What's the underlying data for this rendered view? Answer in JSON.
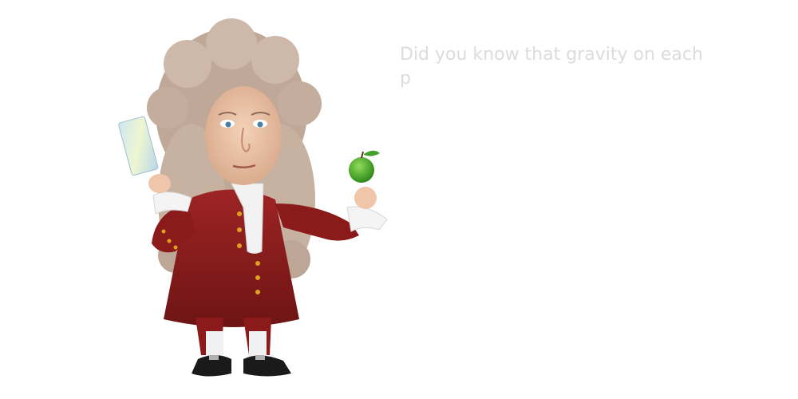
{
  "slide": {
    "text": "Did you know that gravity on each p"
  },
  "illustration": {
    "subject": "scientist-caricature",
    "props": [
      "paper-note",
      "green-apple"
    ]
  },
  "colors": {
    "background": "#ffffff",
    "text": "#dcdcdc",
    "coat": "#8b1a1a",
    "wig": "#c9b3a3",
    "apple": "#4caf2a"
  }
}
